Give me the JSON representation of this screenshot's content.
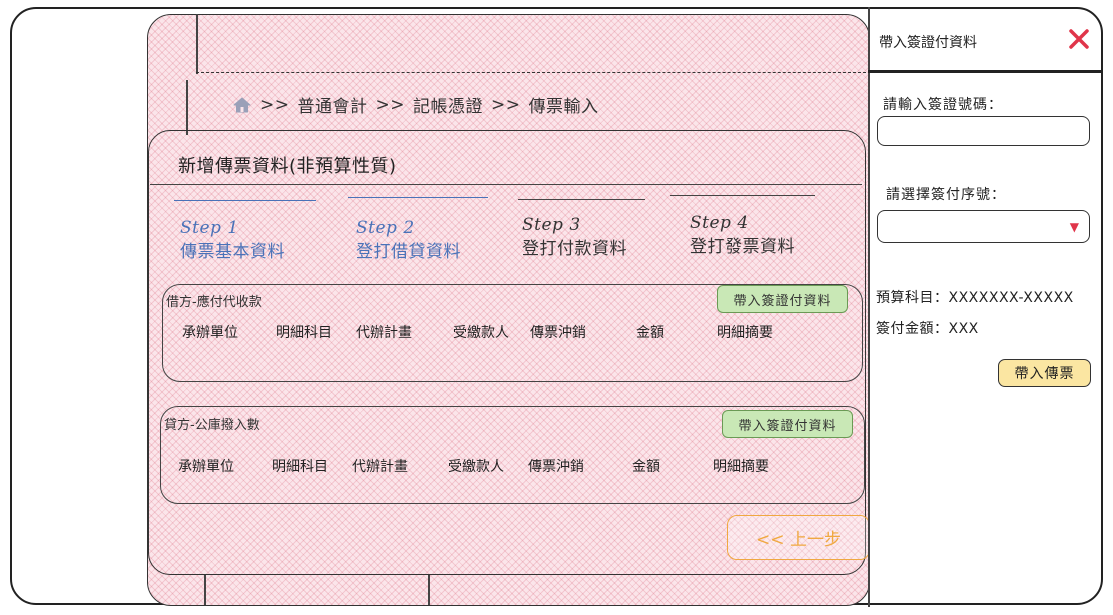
{
  "breadcrumb": {
    "sep1": ">>",
    "item1": "普通會計",
    "sep2": ">>",
    "item2": "記帳憑證",
    "sep3": ">>",
    "item3": "傳票輸入"
  },
  "card": {
    "title": "新增傳票資料(非預算性質)"
  },
  "steps": [
    {
      "num": "Step 1",
      "label": "傳票基本資料",
      "state": "active"
    },
    {
      "num": "Step 2",
      "label": "登打借貸資料",
      "state": "active"
    },
    {
      "num": "Step 3",
      "label": "登打付款資料",
      "state": "todo"
    },
    {
      "num": "Step 4",
      "label": "登打發票資料",
      "state": "todo"
    }
  ],
  "debit": {
    "label": "借方-應付代收款",
    "button": "帶入簽證付資料",
    "columns": [
      "承辦單位",
      "明細科目",
      "代辦計畫",
      "受繳款人",
      "傳票沖銷",
      "金額",
      "明細摘要"
    ]
  },
  "credit": {
    "label": "貸方-公庫撥入數",
    "button": "帶入簽證付資料",
    "columns": [
      "承辦單位",
      "明細科目",
      "代辦計畫",
      "受繳款人",
      "傳票沖銷",
      "金額",
      "明細摘要"
    ]
  },
  "prev_button": {
    "label": "<< 上一步"
  },
  "side": {
    "title": "帶入簽證付資料",
    "input_label": "請輸入簽證號碼：",
    "input_value": "",
    "select_label": "請選擇簽付序號：",
    "select_value": "",
    "budget_text": "預算科目：XXXXXXX-XXXXX",
    "amount_text": "簽付金額：XXX",
    "submit": "帶入傳票"
  },
  "colors": {
    "accent_blue": "#4a72b8",
    "close_red": "#e0354a",
    "prev_orange": "#f0a840",
    "green_btn": "#c9e8b6",
    "yellow_btn": "#fbe6a2",
    "hatch_pink": "#fbe5ea"
  }
}
